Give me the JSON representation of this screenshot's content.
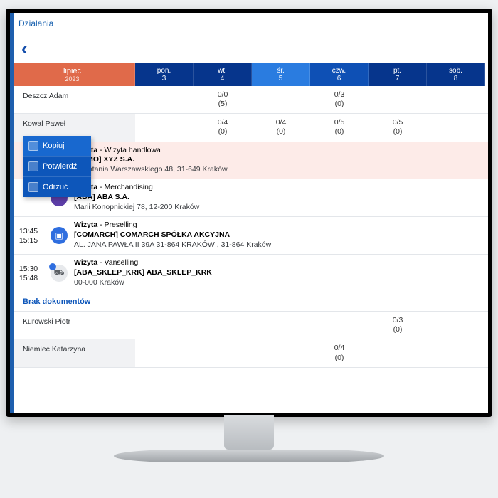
{
  "header": {
    "title": "Działania"
  },
  "calendar": {
    "month": "lipiec",
    "year": "2023",
    "days": [
      {
        "wd": "pon.",
        "dn": "3",
        "tone": "dark"
      },
      {
        "wd": "wt.",
        "dn": "4",
        "tone": "dark"
      },
      {
        "wd": "śr.",
        "dn": "5",
        "tone": "light"
      },
      {
        "wd": "czw.",
        "dn": "6",
        "tone": "mid"
      },
      {
        "wd": "pt.",
        "dn": "7",
        "tone": "dark"
      },
      {
        "wd": "sob.",
        "dn": "8",
        "tone": "dark"
      }
    ]
  },
  "rows": [
    {
      "name": "Deszcz Adam",
      "alt": false,
      "cells": [
        "",
        "0/0\n(5)",
        "",
        "0/3\n(0)",
        "",
        ""
      ]
    },
    {
      "name": "Kowal Paweł",
      "alt": true,
      "cells": [
        "",
        "0/4\n(0)",
        "0/4\n(0)",
        "0/5\n(0)",
        "0/5\n(0)",
        ""
      ]
    }
  ],
  "bottomRows": [
    {
      "name": "Kurowski Piotr",
      "alt": false,
      "cells": [
        "",
        "",
        "",
        "",
        "0/3\n(0)",
        ""
      ]
    },
    {
      "name": "Niemiec Katarzyna",
      "alt": true,
      "cells": [
        "",
        "",
        "",
        "0/4\n(0)",
        "",
        ""
      ]
    }
  ],
  "ctx": {
    "items": [
      {
        "label": "Kopiuj",
        "hl": true
      },
      {
        "label": "Potwierdź",
        "hl": false
      },
      {
        "label": "Odrzuć",
        "hl": false
      }
    ]
  },
  "visits": [
    {
      "pink": true,
      "t1": "",
      "t2": "",
      "icon": "none",
      "type": "Wizyta - Wizyta handlowa",
      "client": "[DEMO] XYZ S.A.",
      "addr": "Powstania Warszawskiego 48, 31-649 Kraków"
    },
    {
      "pink": false,
      "t1": "",
      "t2": "",
      "icon": "purple",
      "type": "Wizyta - Merchandising",
      "client": "[ABA] ABA S.A.",
      "addr": "Marii Konopnickiej 78, 12-200 Kraków"
    },
    {
      "pink": false,
      "t1": "13:45",
      "t2": "15:15",
      "icon": "blue",
      "type": "Wizyta - Preselling",
      "client": "[COMARCH] COMARCH SPÓŁKA AKCYJNA",
      "addr": "AL. JANA PAWŁA II 39A 31-864 KRAKÓW , 31-864 Kraków"
    },
    {
      "pink": false,
      "t1": "15:30",
      "t2": "15:48",
      "icon": "grey",
      "badge": true,
      "type": "Wizyta - Vanselling",
      "client": "[ABA_SKLEP_KRK] ABA_SKLEP_KRK",
      "addr": "00-000 Kraków"
    }
  ],
  "nodoc": "Brak dokumentów",
  "icons": {
    "copy": "copy-icon",
    "confirm": "confirm-icon",
    "reject": "reject-icon",
    "blue_square": "chart-icon",
    "truck": "truck-icon"
  },
  "colors": {
    "brand_blue": "#0d56ba",
    "month_orange": "#e06a4a",
    "highlight_day": "#2a7ce0"
  }
}
